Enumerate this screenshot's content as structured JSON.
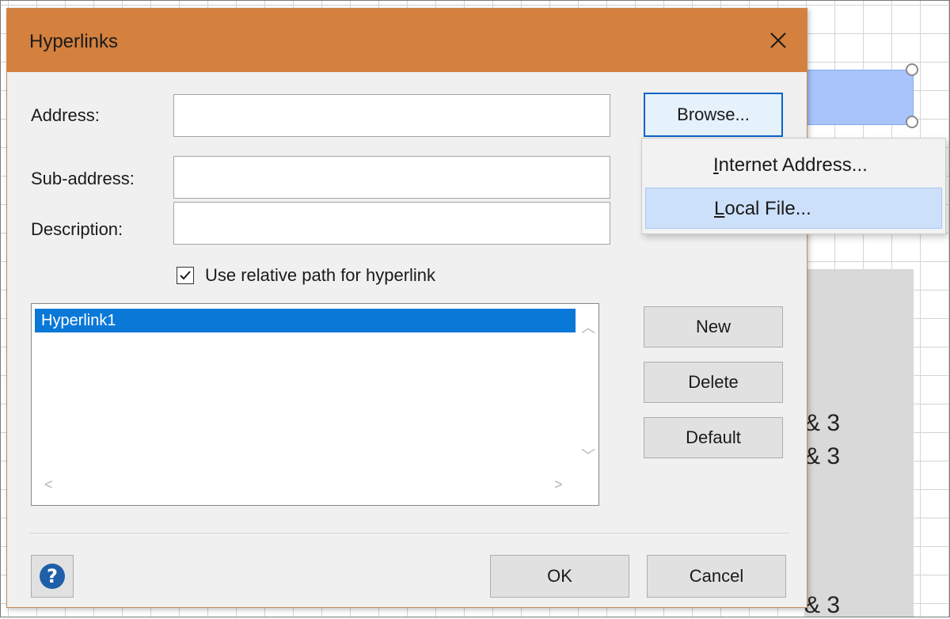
{
  "canvas": {
    "text_lines": [
      "& 3",
      "& 3",
      "& 3"
    ]
  },
  "dialog": {
    "title": "Hyperlinks",
    "close_icon": "close-icon",
    "address_label": "Address:",
    "address_value": "",
    "subaddress_label": "Sub-address:",
    "subaddress_value": "",
    "description_label": "Description:",
    "description_value": "",
    "browse_label": "Browse...",
    "relative_path_label": "Use relative path for hyperlink",
    "relative_path_checked": true,
    "hyperlinks": [
      "Hyperlink1"
    ],
    "new_label": "New",
    "delete_label": "Delete",
    "default_label": "Default",
    "ok_label": "OK",
    "cancel_label": "Cancel",
    "help_icon": "help-icon"
  },
  "browse_menu": {
    "items": [
      {
        "first": "I",
        "rest": "nternet Address..."
      },
      {
        "first": "L",
        "rest": "ocal File..."
      }
    ]
  },
  "colors": {
    "titlebar": "#d4803e",
    "selection": "#0a78d7",
    "menu_hover": "#cde0fa"
  }
}
